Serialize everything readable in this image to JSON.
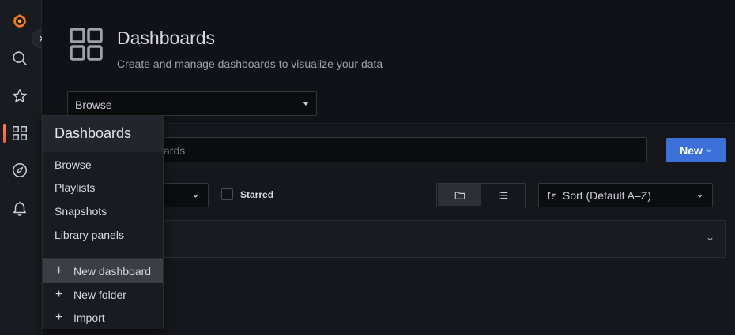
{
  "sidebar": {
    "icons": [
      "grafana-logo-icon",
      "search-icon",
      "star-icon",
      "dashboards-grid-icon",
      "compass-icon",
      "bell-icon"
    ],
    "accent_color": "#ff8833"
  },
  "header": {
    "title": "Dashboards",
    "subtitle": "Create and manage dashboards to visualize your data",
    "view_select_value": "Browse"
  },
  "toolbar": {
    "search_placeholder_visible": "ards",
    "new_button_label": "New",
    "starred_label": "Starred",
    "sort_label": "Sort (Default A–Z)",
    "new_button_color": "#3d71d9"
  },
  "flyout": {
    "title": "Dashboards",
    "items": [
      "Browse",
      "Playlists",
      "Snapshots",
      "Library panels"
    ],
    "actions": [
      "New dashboard",
      "New folder",
      "Import"
    ]
  }
}
